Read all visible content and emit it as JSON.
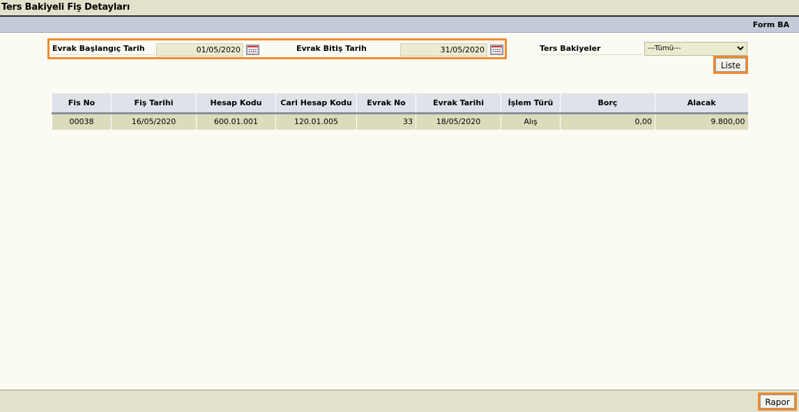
{
  "header": {
    "title": "Ters Bakiyeli Fiş Detayları"
  },
  "formbar": {
    "form_name": "Form BA"
  },
  "filters": {
    "start_label": "Evrak Başlangıç Tarih",
    "start_value": "01/05/2020",
    "end_label": "Evrak Bitiş Tarih",
    "end_value": "31/05/2020",
    "balance_label": "Ters Bakiyeler",
    "balance_selected": "---Tümü---"
  },
  "buttons": {
    "list_label": "Liste",
    "report_label": "Rapor"
  },
  "table": {
    "columns": [
      "Fis No",
      "Fiş Tarihi",
      "Hesap Kodu",
      "Cari Hesap Kodu",
      "Evrak No",
      "Evrak Tarihi",
      "İşlem Türü",
      "Borç",
      "Alacak"
    ],
    "rows": [
      [
        "00038",
        "16/05/2020",
        "600.01.001",
        "120.01.005",
        "33",
        "18/05/2020",
        "Alış",
        "0,00",
        "9.800,00"
      ]
    ]
  },
  "colors": {
    "highlight_border": "#f08a2c",
    "title_bg": "#e2e2cc",
    "formbar_bg": "#c4ccd9",
    "row_bg": "#dcdcbc"
  }
}
